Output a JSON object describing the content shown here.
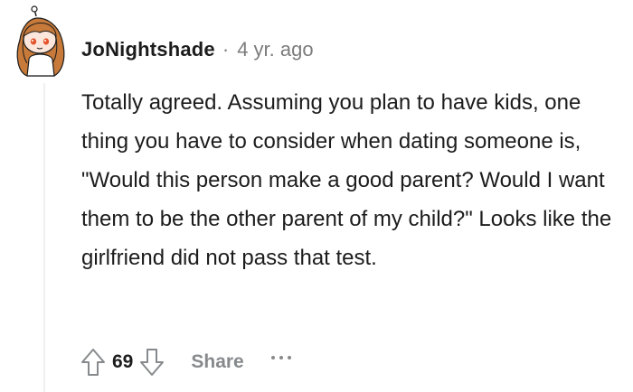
{
  "comment": {
    "author": "JoNightshade",
    "separator": "·",
    "time_ago": "4 yr. ago",
    "body": "Totally agreed. Assuming you plan to have kids, one thing you have to consider when dating someone is, \"Would this person make a good parent? Would I want them to be the other parent of my child?\" Looks like the girlfriend did not pass that test.",
    "score": "69",
    "share_label": "Share"
  },
  "icons": {
    "avatar": "snoo-avatar",
    "upvote": "upvote-arrow-icon",
    "downvote": "downvote-arrow-icon",
    "more": "more-options-icon"
  },
  "colors": {
    "text": "#1c1c1c",
    "meta": "#7c7c7c",
    "action_gray": "#878a8c",
    "thread_line": "#edeff1",
    "avatar_hair": "#c77a3a"
  }
}
